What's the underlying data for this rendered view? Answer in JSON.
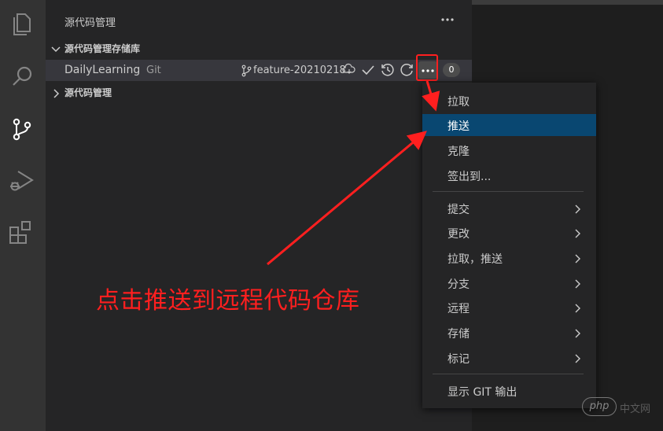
{
  "sidebar": {
    "title": "源代码管理"
  },
  "sections": {
    "repositories": "源代码管理存储库",
    "source_control": "源代码管理"
  },
  "repo": {
    "name": "DailyLearning",
    "type": "Git",
    "branch": "feature-20210218",
    "count": "0"
  },
  "menu": {
    "items": [
      {
        "label": "拉取"
      },
      {
        "label": "推送",
        "selected": true
      },
      {
        "label": "克隆"
      },
      {
        "label": "签出到..."
      },
      {
        "label": "提交",
        "submenu": true
      },
      {
        "label": "更改",
        "submenu": true
      },
      {
        "label": "拉取，推送",
        "submenu": true
      },
      {
        "label": "分支",
        "submenu": true
      },
      {
        "label": "远程",
        "submenu": true
      },
      {
        "label": "存储",
        "submenu": true
      },
      {
        "label": "标记",
        "submenu": true
      },
      {
        "label": "显示 GIT 输出"
      }
    ]
  },
  "annotation": {
    "text": "点击推送到远程代码仓库",
    "color": "#ff1f1f"
  },
  "watermark": {
    "logo": "php",
    "text": "中文网"
  },
  "colors": {
    "activity_bar": "#333333",
    "sidebar": "#252526",
    "selection": "#094771",
    "editor": "#1e1e1e"
  },
  "activity_bar": {
    "icons": [
      "explorer-icon",
      "search-icon",
      "source-control-icon",
      "run-debug-icon",
      "extensions-icon"
    ]
  }
}
